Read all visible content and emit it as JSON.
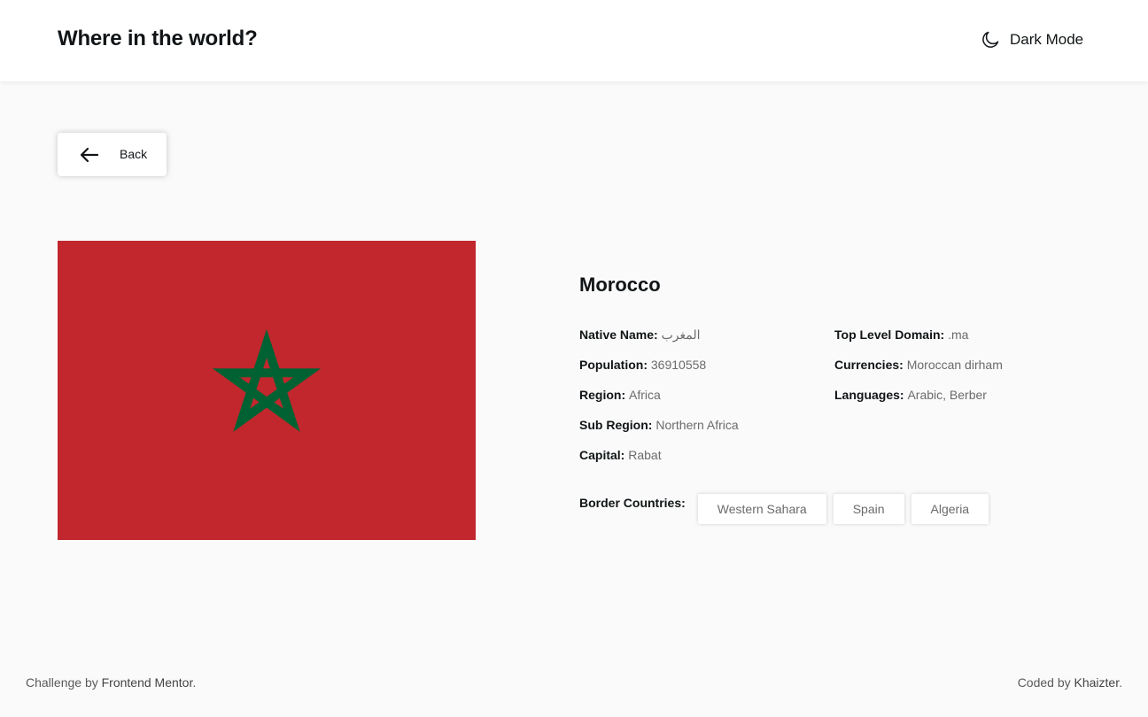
{
  "header": {
    "title": "Where in the world?",
    "theme_toggle_label": "Dark Mode",
    "theme_toggle_icon": "moon-icon"
  },
  "back_button": {
    "label": "Back",
    "icon": "arrow-left-icon"
  },
  "flag": {
    "country": "Morocco",
    "colors": {
      "field": "#c1272d",
      "star": "#006233"
    }
  },
  "country": {
    "name": "Morocco",
    "left_details": [
      {
        "label": "Native Name:",
        "value": "المغرب"
      },
      {
        "label": "Population:",
        "value": "36910558"
      },
      {
        "label": "Region:",
        "value": "Africa"
      },
      {
        "label": "Sub Region:",
        "value": "Northern Africa"
      },
      {
        "label": "Capital:",
        "value": "Rabat"
      }
    ],
    "right_details": [
      {
        "label": "Top Level Domain:",
        "value": ".ma"
      },
      {
        "label": "Currencies:",
        "value": "Moroccan dirham"
      },
      {
        "label": "Languages:",
        "value": "Arabic, Berber"
      }
    ],
    "border_label": "Border Countries:",
    "borders": [
      "Western Sahara",
      "Spain",
      "Algeria"
    ]
  },
  "footer": {
    "left_prefix": "Challenge by",
    "left_link": "Frontend Mentor",
    "left_suffix": ".",
    "right_prefix": "Coded by",
    "right_link": "Khaizter",
    "right_suffix": "."
  },
  "colors": {
    "background": "#fafafa",
    "surface": "#ffffff",
    "text": "#111517",
    "muted": "#6b6b6b"
  }
}
